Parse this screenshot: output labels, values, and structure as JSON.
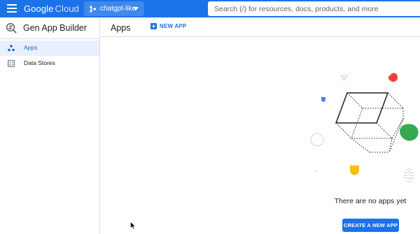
{
  "topbar": {
    "logo_google": "Google",
    "logo_cloud": "Cloud",
    "project_name": "chatgpt-like",
    "search_placeholder": "Search (/) for resources, docs, products, and more"
  },
  "sidebar": {
    "title": "Gen App Builder",
    "items": [
      {
        "label": "Apps",
        "icon": "apps-icon",
        "active": true
      },
      {
        "label": "Data Stores",
        "icon": "data-stores-icon",
        "active": false
      }
    ]
  },
  "main": {
    "title": "Apps",
    "new_app_label": "NEW APP",
    "empty_message": "There are no apps yet",
    "create_button_label": "CREATE A NEW APP"
  },
  "colors": {
    "brand_blue": "#1a73e8",
    "active_bg": "#e8f0fe",
    "illus_red": "#ea4335",
    "illus_green": "#34a853",
    "illus_yellow": "#fbbc04",
    "illus_blue": "#4285f4"
  }
}
